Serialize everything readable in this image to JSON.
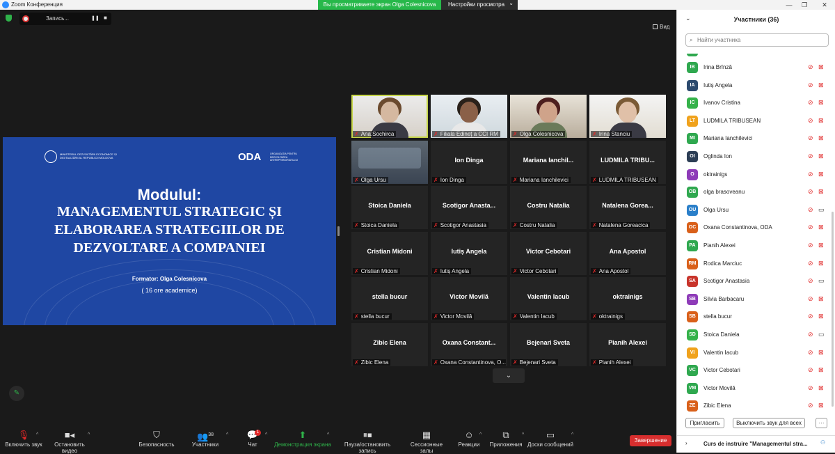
{
  "window": {
    "title": "Zoom Конференция",
    "minimize": "—",
    "maximize": "❐",
    "close": "✕"
  },
  "banner": {
    "viewing": "Вы просматриваете экран Olga Colesnicova",
    "view_settings": "Настройки просмотра",
    "caret": "⌄"
  },
  "recording": {
    "label": "Запись...",
    "pause": "❚❚",
    "stop": "■"
  },
  "view_button": "Вид",
  "slide": {
    "org_left": "MINISTERUL DEZVOLTĂRII ECONOMICE ȘI DIGITALIZĂRII AL REPUBLICII MOLDOVA",
    "oda_logo": "ODA",
    "oda_sub": "ORGANIZAȚIA PENTRU DEZVOLTAREA ANTREPRENORIATULUI",
    "heading": "Modulul:",
    "title_lines": [
      "MANAGEMENTUL STRATEGIC ȘI",
      "ELABORAREA STRATEGIILOR DE",
      "DEZVOLTARE A COMPANIEI"
    ],
    "formator": "Formator: Olga Colesnicova",
    "hours": "( 16 ore academice)"
  },
  "gallery": [
    {
      "name": "",
      "label": "Ana.Sochirca",
      "video": true
    },
    {
      "name": "",
      "label": "Filiala Edineț a CCI RM",
      "video": true
    },
    {
      "name": "",
      "label": "Olga Colesnicova",
      "video": true
    },
    {
      "name": "",
      "label": "Irina Stanciu",
      "video": true
    },
    {
      "name": "",
      "label": "Olga Ursu",
      "video": true
    },
    {
      "name": "Ion Dinga",
      "label": "Ion Dinga"
    },
    {
      "name": "Mariana Ianchil...",
      "label": "Mariana Ianchilevici"
    },
    {
      "name": "LUDMILA TRIBU...",
      "label": "LUDMILA TRIBUSEAN"
    },
    {
      "name": "Stoica Daniela",
      "label": "Stoica Daniela"
    },
    {
      "name": "Scotigor Anasta...",
      "label": "Scotigor Anastasia"
    },
    {
      "name": "Costru Natalia",
      "label": "Costru Natalia"
    },
    {
      "name": "Natalena Gorea...",
      "label": "Natalena Goreacica"
    },
    {
      "name": "Cristian Midoni",
      "label": "Cristian Midoni"
    },
    {
      "name": "Iutiș Angela",
      "label": "Iutiș Angela"
    },
    {
      "name": "Victor Cebotari",
      "label": "Victor Cebotari"
    },
    {
      "name": "Ana Apostol",
      "label": "Ana Apostol"
    },
    {
      "name": "stella bucur",
      "label": "stella bucur"
    },
    {
      "name": "Victor Movilă",
      "label": "Victor Movilă"
    },
    {
      "name": "Valentin Iacub",
      "label": "Valentin Iacub"
    },
    {
      "name": "oktrainigs",
      "label": "oktrainigs"
    },
    {
      "name": "Zibic Elena",
      "label": "Zibic Elena"
    },
    {
      "name": "Oxana Constant...",
      "label": "Oxana Constantinova, O..."
    },
    {
      "name": "Bejenari Sveta",
      "label": "Bejenari Sveta"
    },
    {
      "name": "Pianih Alexei",
      "label": "Pianih Alexei"
    }
  ],
  "toolbar": {
    "unmute": "Включить звук",
    "start_video": "Остановить видео",
    "security": "Безопасность",
    "participants": "Участники",
    "participants_count": "38",
    "chat": "Чат",
    "chat_badge": "1",
    "share": "Демонстрация экрана",
    "pause_share": "Пауза/остановить запись",
    "breakout": "Сессионные залы",
    "reactions": "Реакции",
    "apps": "Приложения",
    "whiteboards": "Доски сообщений",
    "end": "Завершение"
  },
  "panel": {
    "title": "Участники (36)",
    "search_placeholder": "Найти участника",
    "invite": "Пригласить",
    "mute_all": "Выключить звук для всех",
    "more": "···",
    "chat_title": "Curs de instruire \"Managementul stra..."
  },
  "participants": [
    {
      "initials": "IB",
      "name": "Irina Brînză",
      "color": "#2fa84f",
      "cam_off": true
    },
    {
      "initials": "IA",
      "name": "Iutiș Angela",
      "color": "#2c4a6e",
      "cam_off": true
    },
    {
      "initials": "IC",
      "name": "Ivanov Cristina",
      "color": "#35b24a",
      "cam_off": true
    },
    {
      "initials": "LT",
      "name": "LUDMILA TRIBUSEAN",
      "color": "#f0a21c",
      "cam_off": true
    },
    {
      "initials": "MI",
      "name": "Mariana Ianchilevici",
      "color": "#2fa84f",
      "cam_off": true
    },
    {
      "initials": "OI",
      "name": "Oglinda Ion",
      "color": "#2c3e55",
      "cam_off": true
    },
    {
      "initials": "O",
      "name": "oktrainigs",
      "color": "#8e3bb8",
      "cam_off": true
    },
    {
      "initials": "OB",
      "name": "olga brasoveanu",
      "color": "#2fa84f",
      "cam_off": true
    },
    {
      "initials": "OU",
      "name": "Olga Ursu",
      "color": "#2a7fc9",
      "cam_off": false
    },
    {
      "initials": "OC",
      "name": "Oxana Constantinova, ODA",
      "color": "#d9601a",
      "cam_off": true
    },
    {
      "initials": "PA",
      "name": "Pianih Alexei",
      "color": "#2fa84f",
      "cam_off": true
    },
    {
      "initials": "RM",
      "name": "Rodica Marciuc",
      "color": "#d9601a",
      "cam_off": true
    },
    {
      "initials": "SA",
      "name": "Scotigor Anastasia",
      "color": "#c8342b",
      "cam_off": false
    },
    {
      "initials": "SB",
      "name": "Silvia Barbacaru",
      "color": "#8e3bb8",
      "cam_off": true
    },
    {
      "initials": "SB",
      "name": "stella bucur",
      "color": "#d9601a",
      "cam_off": true
    },
    {
      "initials": "SD",
      "name": "Stoica Daniela",
      "color": "#35b24a",
      "cam_off": false
    },
    {
      "initials": "VI",
      "name": "Valentin Iacub",
      "color": "#f0a21c",
      "cam_off": true
    },
    {
      "initials": "VC",
      "name": "Victor Cebotari",
      "color": "#2fa84f",
      "cam_off": true
    },
    {
      "initials": "VM",
      "name": "Victor Movilă",
      "color": "#2fa84f",
      "cam_off": true
    },
    {
      "initials": "ZE",
      "name": "Zibic Elena",
      "color": "#d9601a",
      "cam_off": true
    }
  ],
  "icons": {
    "muted_mic": "🎙",
    "cam_off": "⊘",
    "cam_on": "▭"
  }
}
